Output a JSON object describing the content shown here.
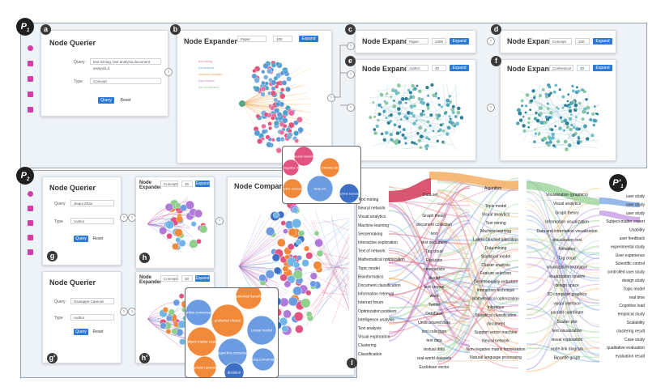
{
  "panels": {
    "P1": "P",
    "P1_sub": "1",
    "P2": "P",
    "P2_sub": "2",
    "P1prime": "P'",
    "P1prime_sub": "1"
  },
  "letters": {
    "a": "a",
    "b": "b",
    "c": "c",
    "d": "d",
    "e": "e",
    "f": "f",
    "g": "g",
    "gprime": "g'",
    "h": "h",
    "hprime": "h'",
    "l": "l"
  },
  "querier_a": {
    "title": "Node Querier",
    "query_label": "Query",
    "query_value": "text mining, text analysis,document analysis,d",
    "type_label": "Type",
    "type_value": "Concept",
    "query_button": "Query",
    "reset_button": "Reset"
  },
  "expander_b": {
    "title": "Node Expander",
    "type": "Paper",
    "count": "100",
    "button": "Expand"
  },
  "expander_c": {
    "title": "Node Expander",
    "type": "Paper",
    "count": "1000",
    "button": "Expand"
  },
  "expander_d": {
    "title": "Node Expander",
    "type": "Concept",
    "count": "100",
    "button": "Expand"
  },
  "expander_e": {
    "title": "Node Expander",
    "type": "Author",
    "count": "40",
    "button": "Expand"
  },
  "expander_f": {
    "title": "Node Expander",
    "type": "Conference",
    "count": "30",
    "button": "Expand"
  },
  "querier_g": {
    "title": "Node Querier",
    "query_label": "Query",
    "query_value": "Jiequi Zhao",
    "type_label": "Type",
    "type_value": "Author",
    "query_button": "Query",
    "reset_button": "Reset"
  },
  "querier_gprime": {
    "title": "Node Querier",
    "query_label": "Query",
    "query_value": "Giuseppe Carenini",
    "type_label": "Type",
    "type_value": "Author",
    "query_button": "Query",
    "reset_button": "Reset"
  },
  "expander_h": {
    "title": "Node\nExpander",
    "type": "Concept",
    "count": "30",
    "button": "Expand"
  },
  "expander_hprime": {
    "title": "Node\nExpander",
    "type": "Concept",
    "count": "30",
    "button": "Expand"
  },
  "comparer": {
    "title": "Node Comparer"
  },
  "zoom_top": {
    "bubbles": [
      "Neural network",
      "Non-negative matrix",
      "Latent Dirichlet allocation",
      "Data set",
      "empiric converge",
      "Machine translatio"
    ]
  },
  "zoom_bottom": {
    "bubbles": [
      "potential benefit",
      "online conversat",
      "preferred choice",
      "Linear model",
      "Subject-matter expert",
      "asynchro-conversa",
      "long conversat",
      "decision process",
      "decision"
    ]
  },
  "flow": {
    "left_terms": [
      "Text mining",
      "Neural network",
      "Visual analytics",
      "Machine learning",
      "Sensemaking",
      "Interactive exploration",
      "Text of network",
      "Mathematical optimization",
      "Topic model",
      "Bioinformatics",
      "Document classification",
      "Information retrieval",
      "Internet forum",
      "Optimization problem",
      "Intelligence analysis",
      "Text analysis",
      "Visual exploration",
      "Clustering",
      "Classification"
    ],
    "mid_terms": [
      "Graph theory",
      "document collection",
      "text",
      "text document",
      "Tag cloud",
      "Evolution",
      "news article",
      "cluster",
      "text corpus",
      "word",
      "Twitter",
      "Database",
      "Unstructured data",
      "text collection",
      "text data",
      "textual data",
      "real-world datasets",
      "Euclidean vector"
    ],
    "top_terms": [
      "Data set",
      "Algorithm"
    ],
    "center_terms": [
      "Topic model",
      "Visual analytics",
      "Text mining",
      "Machine learning",
      "Latent Dirichlet allocation",
      "Data mining",
      "Statistical model",
      "Cluster analysis",
      "Feature selection",
      "Dimensionality reduction",
      "Interaction technique",
      "Mathematical optimization",
      "Inference",
      "Statistical classification",
      "document",
      "Support vector machine",
      "Neural network",
      "Non-negative matrix factorization",
      "Natural language processing"
    ],
    "right_terms": [
      "Visualization (graphics)",
      "Visual analytics",
      "Graph theory",
      "Information visualization",
      "Data and information visualization",
      "visualization tool",
      "Metaphor",
      "Tag cloud",
      "visualization technique",
      "visualization system",
      "design space",
      "3D computer graphics",
      "visual interface",
      "parallel coordinate",
      "Scatter plot",
      "text visualization",
      "visual exploration",
      "node-link diagram",
      "Bipartite graph"
    ],
    "far_right_terms": [
      "user study",
      "user study",
      "user study",
      "Subject-matter expert",
      "Usability",
      "user feedback",
      "experimental study",
      "User experience",
      "Scientific control",
      "controlled user study",
      "design study",
      "Topic model",
      "real time",
      "Cognitive load",
      "empirical study",
      "Scalability",
      "clustering result",
      "Case study",
      "qualitative evaluation",
      "evaluation result"
    ]
  },
  "expander_b_legend": [
    "text mining",
    "text analysis",
    "document analysis",
    "topic models",
    "text visualization"
  ]
}
